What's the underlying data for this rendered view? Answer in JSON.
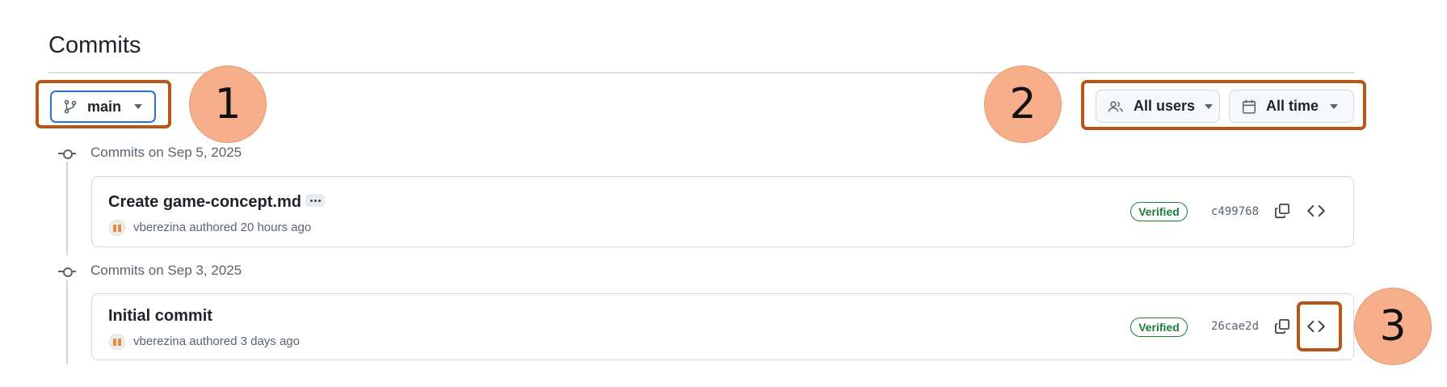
{
  "page": {
    "title": "Commits"
  },
  "toolbar": {
    "branch_label": "main",
    "users_label": "All users",
    "time_label": "All time"
  },
  "groups": [
    {
      "heading": "Commits on Sep 5, 2025",
      "commits": [
        {
          "title": "Create game-concept.md",
          "author": "vberezina",
          "meta_suffix": "authored 20 hours ago",
          "badge": "Verified",
          "sha": "c499768"
        }
      ]
    },
    {
      "heading": "Commits on Sep 3, 2025",
      "commits": [
        {
          "title": "Initial commit",
          "author": "vberezina",
          "meta_suffix": "authored 3 days ago",
          "badge": "Verified",
          "sha": "26cae2d"
        }
      ]
    }
  ],
  "annotations": [
    {
      "number": "1"
    },
    {
      "number": "2"
    },
    {
      "number": "3"
    }
  ],
  "colors": {
    "highlight": "#b85518",
    "callout": "#f7ae8a",
    "verified": "#1a7f37",
    "branch_border": "#2f6fd1"
  },
  "icons": [
    "git-branch-icon",
    "people-icon",
    "calendar-icon",
    "kebab-horizontal-icon",
    "copy-icon",
    "code-icon",
    "avatar-icon"
  ]
}
